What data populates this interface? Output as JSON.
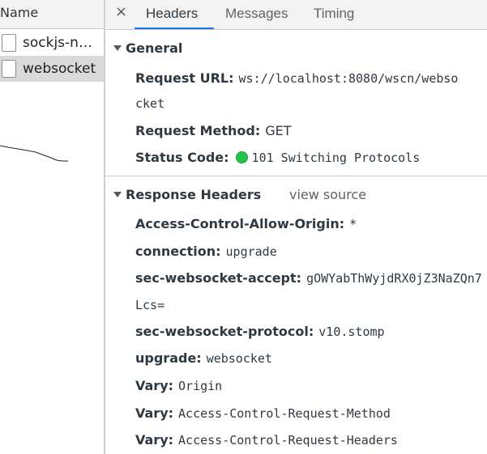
{
  "request_list": {
    "header": "Name",
    "items": [
      {
        "name": "sockjs-no…",
        "selected": false
      },
      {
        "name": "websocket",
        "selected": true
      }
    ]
  },
  "detail": {
    "close_glyph": "×",
    "tabs": [
      {
        "label": "Headers",
        "active": true
      },
      {
        "label": "Messages",
        "active": false
      },
      {
        "label": "Timing",
        "active": false
      }
    ],
    "general": {
      "title": "General",
      "request_url_label": "Request URL:",
      "request_url_line1": "ws://localhost:8080/wscn/webso",
      "request_url_line2": "cket",
      "request_method_label": "Request Method:",
      "request_method_value": "GET",
      "status_code_label": "Status Code:",
      "status_code_value": "101 Switching Protocols",
      "status_color": "#1fc44b"
    },
    "response_headers": {
      "title": "Response Headers",
      "view_source": "view source",
      "rows": [
        {
          "key": "Access-Control-Allow-Origin:",
          "value": "*"
        },
        {
          "key": "connection:",
          "value": "upgrade"
        },
        {
          "key": "sec-websocket-accept:",
          "value": "gOWYabThWyjdRX0jZ3NaZQn7",
          "value_line2": "Lcs="
        },
        {
          "key": "sec-websocket-protocol:",
          "value": "v10.stomp"
        },
        {
          "key": "upgrade:",
          "value": "websocket"
        },
        {
          "key": "Vary:",
          "value": "Origin"
        },
        {
          "key": "Vary:",
          "value": "Access-Control-Request-Method"
        },
        {
          "key": "Vary:",
          "value": "Access-Control-Request-Headers"
        }
      ]
    }
  },
  "accent_color": "#1a73e8"
}
